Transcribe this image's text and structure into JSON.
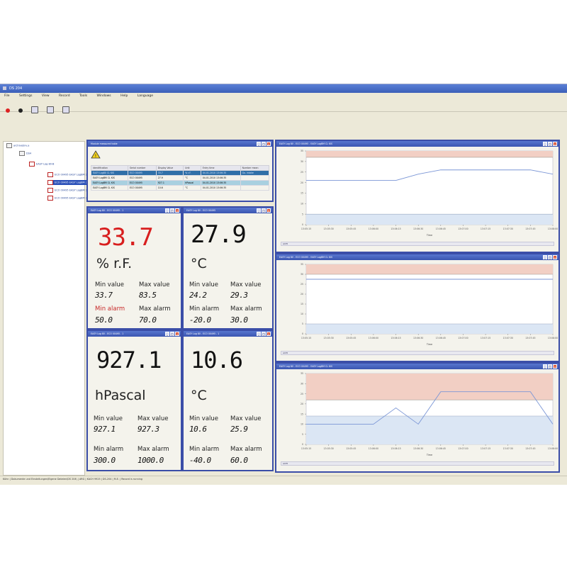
{
  "app": {
    "title": "DS 204",
    "menu": [
      "File",
      "Settings",
      "View",
      "Record",
      "Tools",
      "Windows",
      "Help",
      "Language"
    ],
    "status": "Kühn | Dokumente und Einstellungen\\Eigene Dateien\\DS 204\\ | ARG | KACH 9925 | DS-204 | M.E. | Record is running"
  },
  "tree": {
    "root": "archiveEnv.a",
    "device": "DS4",
    "group": "EASY Log 80-B",
    "items": [
      "ECO 00495\nEASY LogBM 3",
      "ECO 00495\nEASY LogBM 3",
      "ECO 00495\nEASY LogBM 3",
      "ECO 00495\nEASY LogBM 3"
    ]
  },
  "table_window": {
    "title": "Module measured table",
    "headers": [
      "Identification",
      "Serial number",
      "Display Value",
      "Unit",
      "Entry time",
      "Number mean"
    ],
    "rows": [
      [
        "EASY Log80 CL KIS",
        "ECO 00495",
        "33.7",
        "% r.F.",
        "04.01.2010 13:06:35",
        "Go. intake"
      ],
      [
        "EASY LogBM CL KIS",
        "ECO 00495",
        "27.9",
        "°C",
        "04.01.2010 13:06:35",
        ""
      ],
      [
        "EASY LogBM CL KIS",
        "ECO 00495",
        "927.1",
        "hPascal",
        "04.01.2010 13:06:35",
        ""
      ],
      [
        "EASY LogBM CL KIS",
        "ECO 00495",
        "10.6",
        "°C",
        "04.01.2010 13:06:35",
        ""
      ]
    ]
  },
  "displays": [
    {
      "title": "EASY Log 80 - ECO 00495 - 1",
      "value": "33.7",
      "unit": "% r.F.",
      "min_label": "Min value",
      "min": "33.7",
      "max_label": "Max value",
      "max": "83.5",
      "min_alarm_label": "Min alarm",
      "min_alarm": "50.0",
      "max_alarm_label": "Max alarm",
      "max_alarm": "70.0",
      "value_color": "#d81e1e",
      "min_alarm_color": "#c82828"
    },
    {
      "title": "EASY Log 80 - ECO 00495",
      "value": "27.9",
      "unit": "°C",
      "min_label": "Min value",
      "min": "24.2",
      "max_label": "Max value",
      "max": "29.3",
      "min_alarm_label": "Min alarm",
      "min_alarm": "-20.0",
      "max_alarm_label": "Max alarm",
      "max_alarm": "30.0",
      "value_color": "#111111",
      "min_alarm_color": "#222222"
    },
    {
      "title": "EASY Log 80 - ECO 00495 - 1",
      "value": "927.1",
      "unit": "hPascal",
      "min_label": "Min value",
      "min": "927.1",
      "max_label": "Max value",
      "max": "927.3",
      "min_alarm_label": "Min alarm",
      "min_alarm": "300.0",
      "max_alarm_label": "Max alarm",
      "max_alarm": "1000.0",
      "value_color": "#111111",
      "min_alarm_color": "#222222"
    },
    {
      "title": "EASY Log 80 - ECO 00495 - 1",
      "value": "10.6",
      "unit": "°C",
      "min_label": "Min value",
      "min": "10.6",
      "max_label": "Max value",
      "max": "25.9",
      "min_alarm_label": "Min alarm",
      "min_alarm": "-40.0",
      "max_alarm_label": "Max alarm",
      "max_alarm": "60.0",
      "value_color": "#111111",
      "min_alarm_color": "#222222"
    }
  ],
  "charts": [
    {
      "title": "EASY Log 80 - ECO 00495 - EASY LogBM CL KIS",
      "scroll_label": "ACHI"
    },
    {
      "title": "EASY Log 80 - ECO 00495 - EASY LogBM CL KIS",
      "scroll_label": "ACHI"
    },
    {
      "title": "EASY Log 80 - ECO 00495 - EASY LogBM CL KIS",
      "scroll_label": "ACHI"
    }
  ],
  "chart_data": [
    {
      "type": "line",
      "title": "",
      "xlabel": "Time",
      "ylabel": "",
      "x": [
        "13:05:15",
        "13:05:30",
        "13:05:45",
        "13:06:00",
        "13:06:15",
        "13:06:30",
        "13:06:45",
        "13:07:00",
        "13:07:15",
        "13:07:30",
        "13:07:45",
        "13:08:00"
      ],
      "series": [
        {
          "values": [
            21,
            21,
            21,
            21,
            21,
            24,
            26,
            26,
            26,
            26,
            26,
            24
          ]
        }
      ],
      "ylim": [
        0,
        35
      ],
      "alarm_high": 32,
      "alarm_low": 5,
      "colors": {
        "line": "#7b96d6",
        "high": "#f2cfc4",
        "low": "#dbe6f4"
      }
    },
    {
      "type": "line",
      "title": "",
      "xlabel": "Time",
      "x": [
        "13:05:15",
        "13:05:30",
        "13:05:45",
        "13:06:00",
        "13:06:15",
        "13:06:30",
        "13:06:45",
        "13:07:00",
        "13:07:15",
        "13:07:30",
        "13:07:45",
        "13:08:00"
      ],
      "series": [
        {
          "values": [
            27.5,
            27.5,
            27.5,
            27.5,
            27.5,
            27.5,
            27.5,
            27.5,
            27.5,
            27.5,
            27.5,
            27.5
          ]
        }
      ],
      "ylim": [
        0,
        35
      ],
      "alarm_high": 30,
      "alarm_low": 5,
      "colors": {
        "line": "#7b96d6",
        "high": "#f2cfc4",
        "low": "#dbe6f4"
      }
    },
    {
      "type": "line",
      "title": "",
      "xlabel": "Time",
      "x": [
        "13:05:15",
        "13:05:30",
        "13:05:45",
        "13:06:00",
        "13:06:15",
        "13:06:30",
        "13:06:45",
        "13:07:00",
        "13:07:15",
        "13:07:30",
        "13:07:45",
        "13:08:00"
      ],
      "series": [
        {
          "values": [
            10,
            10,
            10,
            10,
            18,
            10,
            26,
            26,
            26,
            26,
            26,
            10
          ]
        }
      ],
      "ylim": [
        0,
        35
      ],
      "alarm_high": 22,
      "alarm_low": 14,
      "colors": {
        "line": "#7b96d6",
        "high": "#f2cfc4",
        "low": "#dbe6f4"
      }
    }
  ]
}
